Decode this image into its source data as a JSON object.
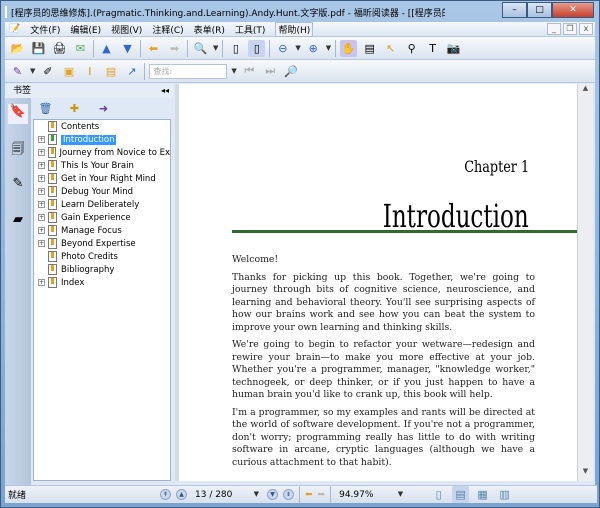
{
  "window": {
    "title": "[程序员的思维修炼].(Pragmatic.Thinking.and.Learning).Andy.Hunt.文字版.pdf - 福昕阅读器 - [[程序员的思维修炼].(Pragma...",
    "minimize": "–",
    "maximize": "□",
    "close": "✕"
  },
  "menu": [
    "文件(F)",
    "编辑(E)",
    "视图(V)",
    "注释(C)",
    "表单(R)",
    "工具(T)",
    "帮助(H)"
  ],
  "mdi": [
    "_",
    "❐",
    "x"
  ],
  "search": {
    "placeholder": "查找:"
  },
  "panel": {
    "title": "书签",
    "collapse": "◂◂"
  },
  "bookmarks": [
    {
      "label": "Contents",
      "expandable": false
    },
    {
      "label": "Introduction",
      "expandable": true,
      "selected": true
    },
    {
      "label": "Journey from Novice to Ex",
      "expandable": true
    },
    {
      "label": "This Is Your Brain",
      "expandable": true
    },
    {
      "label": "Get in Your Right Mind",
      "expandable": true
    },
    {
      "label": "Debug Your Mind",
      "expandable": true
    },
    {
      "label": "Learn Deliberately",
      "expandable": true
    },
    {
      "label": "Gain Experience",
      "expandable": true
    },
    {
      "label": "Manage Focus",
      "expandable": true
    },
    {
      "label": "Beyond Expertise",
      "expandable": true
    },
    {
      "label": "Photo Credits",
      "expandable": false
    },
    {
      "label": "Bibliography",
      "expandable": false
    },
    {
      "label": "Index",
      "expandable": true
    }
  ],
  "page": {
    "chapter": "Chapter 1",
    "heading": "Introduction",
    "paragraphs": [
      "Welcome!",
      "Thanks for picking up this book. Together, we're going to journey through bits of cognitive science, neuroscience, and learning and behavioral theory. You'll see surprising aspects of how our brains work and see how you can beat the system to improve your own learning and thinking skills.",
      "We're going to begin to refactor your wetware—redesign and rewire your brain—to make you more effective at your job. Whether you're a programmer, manager, \"knowledge worker,\" technogeek, or deep thinker, or if you just happen to have a human brain you'd like to crank up, this book will help.",
      "I'm a programmer, so my examples and rants will be directed at the world of software development. If you're not a programmer, don't worry; programming really has little to do with writing software in arcane, cryptic languages (although we have a curious attachment to that habit)."
    ]
  },
  "status": {
    "text": "就绪",
    "page": "13 / 280",
    "zoom": "94.97%"
  }
}
